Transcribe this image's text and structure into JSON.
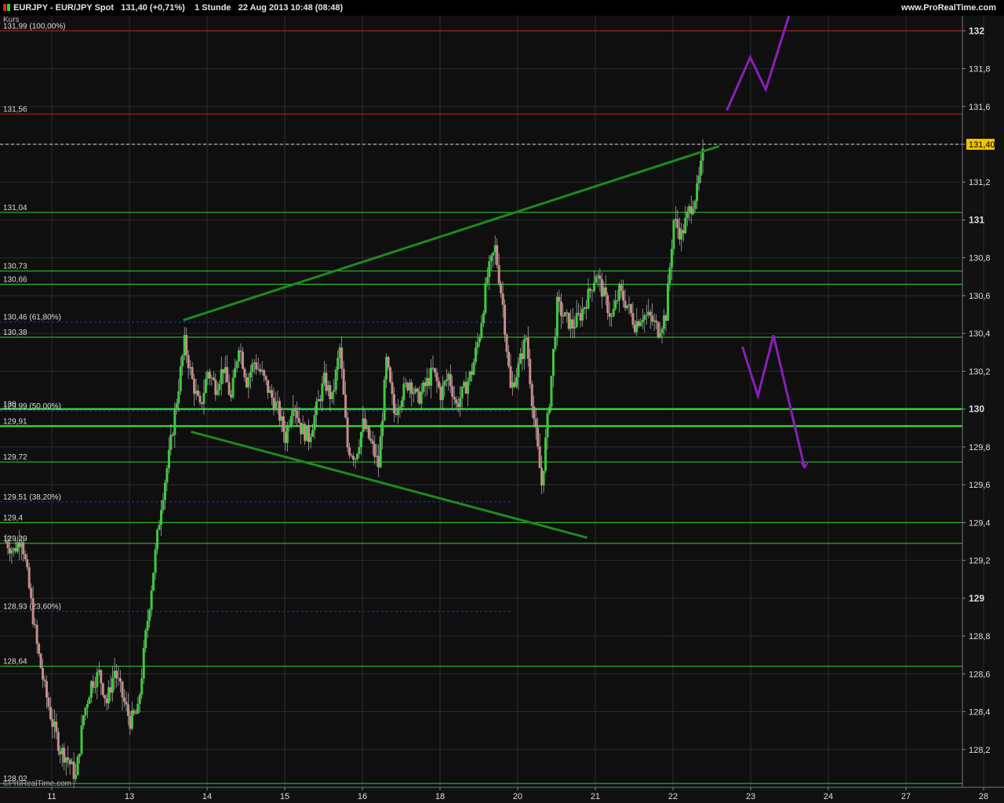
{
  "header": {
    "symbol": "EURJPY - EUR/JPY Spot",
    "price": "131,40 (+0,71%)",
    "timeframe": "1 Stunde",
    "datetime": "22 Aug 2013 10:48 (08:48)",
    "brand": "www.ProRealTime.com",
    "panel_label": "Kurs",
    "watermark": "©ProRealTime.com"
  },
  "colors": {
    "background": "#0f0f0f",
    "grid": "#2c2c2c",
    "support_resistance": "#2ed32e",
    "trendline": "#1e8a1e",
    "fib": "#2a2ac8",
    "red_level": "#c81e1e",
    "projection": "#8a1fb8",
    "candle_up": "#3fc93f",
    "candle_down": "#c98a8a",
    "current_price_box": "#f2c400"
  },
  "chart_data": {
    "type": "candlestick",
    "title": "EURJPY - EUR/JPY Spot",
    "ylim": [
      128.0,
      132.08
    ],
    "y_ticks": [
      "132",
      "131,8",
      "131,6",
      "131,4",
      "131,2",
      "131",
      "130,8",
      "130,6",
      "130,4",
      "130,2",
      "130",
      "129,8",
      "129,6",
      "129,4",
      "129,2",
      "129",
      "128,8",
      "128,6",
      "128,4",
      "128,2"
    ],
    "y_tick_values": [
      132,
      131.8,
      131.6,
      131.4,
      131.2,
      131,
      130.8,
      130.6,
      130.4,
      130.2,
      130,
      129.8,
      129.6,
      129.4,
      129.2,
      129,
      128.8,
      128.6,
      128.4,
      128.2
    ],
    "x_ticks": [
      "11",
      "13",
      "14",
      "15",
      "16",
      "18",
      "20",
      "21",
      "22",
      "23",
      "24",
      "27",
      "28"
    ],
    "x_tick_index": [
      0,
      10,
      20,
      30,
      40,
      50,
      60,
      70,
      80,
      90,
      100,
      110,
      120
    ],
    "current_price": 131.4,
    "current_price_label": "131,40",
    "horizontal_levels": [
      {
        "value": 132.0,
        "label": "131,99 (100,00%)",
        "kind": "red"
      },
      {
        "value": 131.56,
        "label": "131,56",
        "kind": "red"
      },
      {
        "value": 131.04,
        "label": "131,04",
        "kind": "green"
      },
      {
        "value": 130.73,
        "label": "130,73",
        "kind": "green"
      },
      {
        "value": 130.66,
        "label": "130,66",
        "kind": "green"
      },
      {
        "value": 130.46,
        "label": "130,46 (61,80%)",
        "kind": "fib"
      },
      {
        "value": 130.38,
        "label": "130,38",
        "kind": "green"
      },
      {
        "value": 130.0,
        "label": "130",
        "kind": "green-thick"
      },
      {
        "value": 129.99,
        "label": "129,99 (50,00%)",
        "kind": "fib"
      },
      {
        "value": 129.91,
        "label": "129,91",
        "kind": "green-thick"
      },
      {
        "value": 129.72,
        "label": "129,72",
        "kind": "green"
      },
      {
        "value": 129.51,
        "label": "129,51 (38,20%)",
        "kind": "fib"
      },
      {
        "value": 129.4,
        "label": "129,4",
        "kind": "green"
      },
      {
        "value": 129.29,
        "label": "129,29",
        "kind": "green"
      },
      {
        "value": 128.93,
        "label": "128,93 (23,60%)",
        "kind": "fib"
      },
      {
        "value": 128.64,
        "label": "128,64",
        "kind": "green"
      },
      {
        "value": 128.02,
        "label": "128,02",
        "kind": "green"
      }
    ],
    "trendlines": [
      {
        "from": [
          23,
          130.47
        ],
        "to": [
          92,
          131.39
        ]
      },
      {
        "from": [
          24,
          129.88
        ],
        "to": [
          75,
          129.32
        ]
      }
    ],
    "projections": [
      [
        [
          93,
          131.58
        ],
        [
          96,
          131.86
        ],
        [
          98,
          131.69
        ],
        [
          101,
          132.08
        ]
      ],
      [
        [
          95,
          130.33
        ],
        [
          97,
          130.07
        ],
        [
          99,
          130.39
        ],
        [
          103,
          129.69
        ]
      ]
    ],
    "close_path": [
      [
        0,
        129.3
      ],
      [
        1,
        129.25
      ],
      [
        2,
        129.33
      ],
      [
        3,
        129.05
      ],
      [
        4,
        128.75
      ],
      [
        5,
        128.52
      ],
      [
        6,
        128.34
      ],
      [
        7,
        128.2
      ],
      [
        8,
        128.15
      ],
      [
        9,
        128.05
      ],
      [
        10,
        128.38
      ],
      [
        11,
        128.55
      ],
      [
        12,
        128.6
      ],
      [
        13,
        128.45
      ],
      [
        14,
        128.62
      ],
      [
        15,
        128.48
      ],
      [
        16,
        128.35
      ],
      [
        17,
        128.4
      ],
      [
        18,
        128.8
      ],
      [
        19,
        129.15
      ],
      [
        20,
        129.5
      ],
      [
        21,
        129.75
      ],
      [
        22,
        130.05
      ],
      [
        23,
        130.35
      ],
      [
        24,
        130.15
      ],
      [
        25,
        130.0
      ],
      [
        26,
        130.2
      ],
      [
        27,
        130.12
      ],
      [
        28,
        130.22
      ],
      [
        29,
        130.05
      ],
      [
        30,
        130.35
      ],
      [
        31,
        130.15
      ],
      [
        32,
        130.25
      ],
      [
        33,
        130.18
      ],
      [
        34,
        130.08
      ],
      [
        35,
        130.0
      ],
      [
        36,
        129.85
      ],
      [
        37,
        130.05
      ],
      [
        38,
        129.9
      ],
      [
        39,
        129.85
      ],
      [
        40,
        130.0
      ],
      [
        41,
        130.15
      ],
      [
        42,
        130.05
      ],
      [
        43,
        130.32
      ],
      [
        44,
        129.8
      ],
      [
        45,
        129.75
      ],
      [
        46,
        129.92
      ],
      [
        47,
        129.82
      ],
      [
        48,
        129.7
      ],
      [
        49,
        130.25
      ],
      [
        50,
        129.98
      ],
      [
        51,
        130.08
      ],
      [
        52,
        130.15
      ],
      [
        53,
        130.05
      ],
      [
        54,
        130.12
      ],
      [
        55,
        130.2
      ],
      [
        56,
        130.08
      ],
      [
        57,
        130.18
      ],
      [
        58,
        130.02
      ],
      [
        59,
        130.1
      ],
      [
        60,
        130.2
      ],
      [
        61,
        130.4
      ],
      [
        62,
        130.7
      ],
      [
        63,
        130.85
      ],
      [
        64,
        130.55
      ],
      [
        65,
        130.1
      ],
      [
        66,
        130.22
      ],
      [
        67,
        130.38
      ],
      [
        68,
        129.95
      ],
      [
        69,
        129.6
      ],
      [
        70,
        130.05
      ],
      [
        71,
        130.55
      ],
      [
        72,
        130.48
      ],
      [
        73,
        130.44
      ],
      [
        74,
        130.5
      ],
      [
        75,
        130.6
      ],
      [
        76,
        130.72
      ],
      [
        77,
        130.6
      ],
      [
        78,
        130.48
      ],
      [
        79,
        130.62
      ],
      [
        80,
        130.55
      ],
      [
        81,
        130.45
      ],
      [
        82,
        130.5
      ],
      [
        83,
        130.48
      ],
      [
        84,
        130.42
      ],
      [
        85,
        130.5
      ],
      [
        86,
        131.0
      ],
      [
        87,
        130.92
      ],
      [
        88,
        131.05
      ],
      [
        89,
        131.15
      ],
      [
        90,
        131.4
      ]
    ]
  }
}
